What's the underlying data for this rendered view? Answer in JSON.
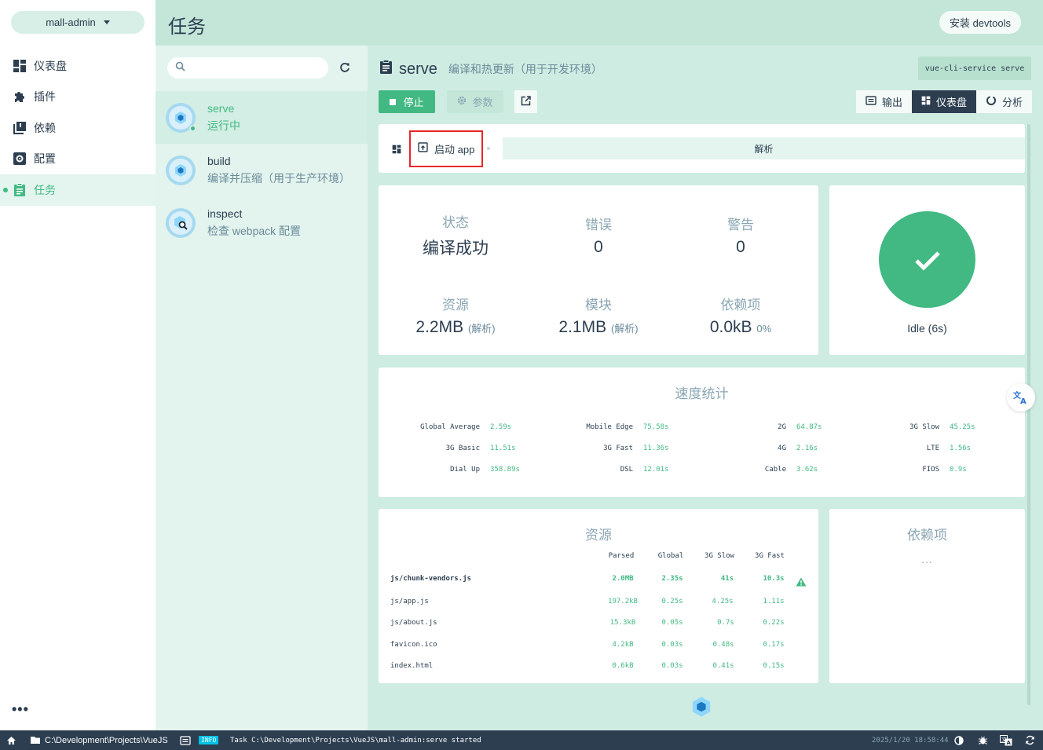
{
  "nav": {
    "project": "mall-admin",
    "items": [
      {
        "label": "仪表盘",
        "icon": "dashboard-icon"
      },
      {
        "label": "插件",
        "icon": "puzzle-icon"
      },
      {
        "label": "依赖",
        "icon": "library-icon"
      },
      {
        "label": "配置",
        "icon": "settings-icon"
      },
      {
        "label": "任务",
        "icon": "assignment-icon",
        "active": true
      }
    ]
  },
  "header": {
    "title": "任务",
    "devtools_label": "安装 devtools"
  },
  "task_list": {
    "search_placeholder": "",
    "tasks": [
      {
        "name": "serve",
        "desc": "运行中",
        "selected": true
      },
      {
        "name": "build",
        "desc": "编译并压缩（用于生产环境）"
      },
      {
        "name": "inspect",
        "desc": "检查 webpack 配置"
      }
    ]
  },
  "task": {
    "title": "serve",
    "desc": "编译和热更新（用于开发环境）",
    "command": "vue-cli-service serve",
    "stop_label": "停止",
    "params_label": "参数",
    "tabs": {
      "output": "输出",
      "dashboard": "仪表盘",
      "analyze": "分析"
    }
  },
  "widgets": {
    "launch_label": "启动 app",
    "analyze_label": "解析"
  },
  "stats": {
    "status_label": "状态",
    "status_value": "编译成功",
    "errors_label": "错误",
    "errors_value": "0",
    "warnings_label": "警告",
    "warnings_value": "0",
    "assets_label": "资源",
    "assets_value": "2.2MB",
    "assets_sub": "(解析)",
    "modules_label": "模块",
    "modules_value": "2.1MB",
    "modules_sub": "(解析)",
    "deps_label": "依赖项",
    "deps_value": "0.0kB",
    "deps_sub": "0%"
  },
  "status": {
    "idle": "Idle (6s)"
  },
  "speed": {
    "title": "速度统计",
    "items": [
      {
        "k": "Global Average",
        "v": "2.59s"
      },
      {
        "k": "Mobile Edge",
        "v": "75.58s"
      },
      {
        "k": "2G",
        "v": "64.87s"
      },
      {
        "k": "3G Slow",
        "v": "45.25s"
      },
      {
        "k": "3G Basic",
        "v": "11.51s"
      },
      {
        "k": "3G Fast",
        "v": "11.36s"
      },
      {
        "k": "4G",
        "v": "2.16s"
      },
      {
        "k": "LTE",
        "v": "1.56s"
      },
      {
        "k": "Dial Up",
        "v": "358.89s"
      },
      {
        "k": "DSL",
        "v": "12.01s"
      },
      {
        "k": "Cable",
        "v": "3.62s"
      },
      {
        "k": "FIOS",
        "v": "0.9s"
      }
    ]
  },
  "assets": {
    "title": "资源",
    "headers": [
      "Parsed",
      "Global",
      "3G Slow",
      "3G Fast"
    ],
    "rows": [
      {
        "name": "js/chunk-vendors.js",
        "parsed": "2.0MB",
        "global": "2.35s",
        "slow": "41s",
        "fast": "10.3s"
      },
      {
        "name": "js/app.js",
        "parsed": "197.2kB",
        "global": "0.25s",
        "slow": "4.25s",
        "fast": "1.11s"
      },
      {
        "name": "js/about.js",
        "parsed": "15.3kB",
        "global": "0.05s",
        "slow": "0.7s",
        "fast": "0.22s"
      },
      {
        "name": "favicon.ico",
        "parsed": "4.2kB",
        "global": "0.03s",
        "slow": "0.48s",
        "fast": "0.17s"
      },
      {
        "name": "index.html",
        "parsed": "0.6kB",
        "global": "0.03s",
        "slow": "0.41s",
        "fast": "0.15s"
      }
    ]
  },
  "deps_card": {
    "title": "依赖项",
    "placeholder": "..."
  },
  "statusbar": {
    "path": "C:\\Development\\Projects\\VueJS",
    "level": "INFO",
    "message": "Task C:\\Development\\Projects\\VueJS\\mall-admin:serve started",
    "time": "2025/1/20 18:58:44"
  },
  "colors": {
    "accent": "#42b983",
    "dark": "#2c3e50",
    "muted": "#8aa6b4",
    "highlight": "#e8262a"
  }
}
